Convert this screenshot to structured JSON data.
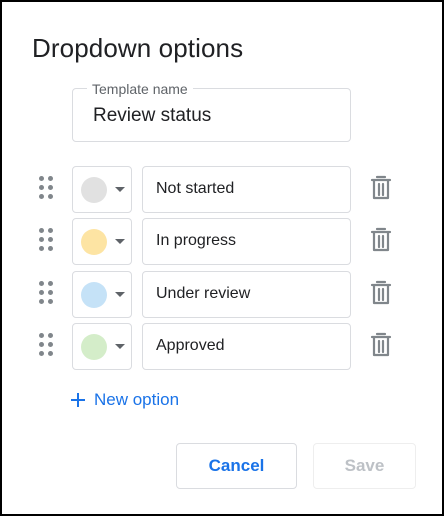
{
  "dialog": {
    "title": "Dropdown options",
    "template": {
      "label": "Template name",
      "value": "Review status"
    },
    "options": [
      {
        "label": "Not started",
        "color": "#e1e1e1"
      },
      {
        "label": "In progress",
        "color": "#fde4a3"
      },
      {
        "label": "Under review",
        "color": "#c5e2f7"
      },
      {
        "label": "Approved",
        "color": "#d4edc9"
      }
    ],
    "new_option_label": "New option",
    "cancel_label": "Cancel",
    "save_label": "Save"
  },
  "colors": {
    "accent": "#1a73e8",
    "border": "#dadce0",
    "icon": "#80868b",
    "disabled_text": "#bdc1c6"
  }
}
